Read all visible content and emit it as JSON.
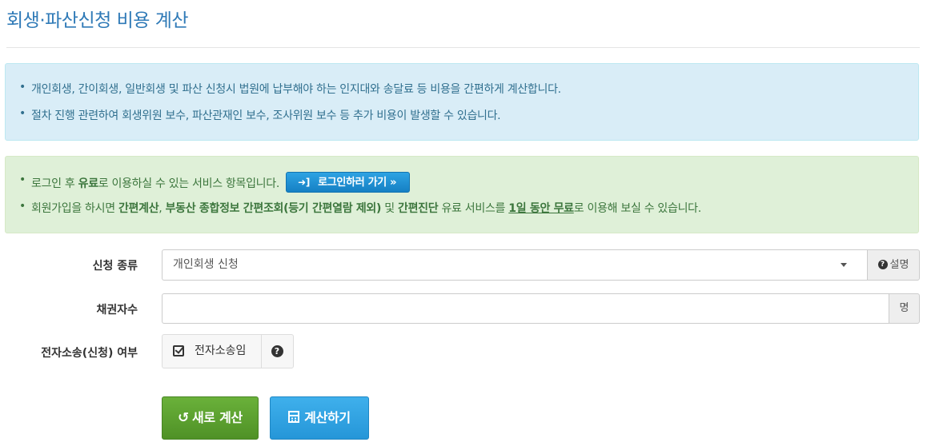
{
  "page": {
    "title": "회생·파산신청 비용 계산"
  },
  "info_alert": {
    "items": [
      "개인회생, 간이회생, 일반회생 및 파산 신청시 법원에 납부해야 하는 인지대와 송달료 등 비용을 간편하게 계산합니다.",
      "절차 진행 관련하여 회생위원 보수, 파산관재인 보수, 조사위원 보수 등 추가 비용이 발생할 수 있습니다."
    ]
  },
  "login_alert": {
    "line1_prefix": "로그인 후 ",
    "line1_bold": "유료",
    "line1_suffix": "로 이용하실 수 있는 서비스 항목입니다.",
    "login_button": "로그인하러 가기 »",
    "line2_a": "회원가입을 하시면 ",
    "line2_b": "간편계산",
    "line2_c": ", ",
    "line2_d": "부동산 종합정보 간편조회(등기 간편열람 제외)",
    "line2_e": " 및 ",
    "line2_f": "간편진단",
    "line2_g": " 유료 서비스를 ",
    "line2_h": "1일 동안 무료",
    "line2_i": "로 이용해 보실 수 있습니다."
  },
  "form": {
    "application_type_label": "신청 종류",
    "application_type_value": "개인회생 신청",
    "help_label": "설명",
    "creditors_label": "채권자수",
    "creditors_value": "",
    "creditors_unit": "명",
    "electronic_label": "전자소송(신청) 여부",
    "electronic_checkbox": "전자소송임",
    "electronic_checked": true
  },
  "buttons": {
    "reset": "새로 계산",
    "calculate": "계산하기"
  },
  "colors": {
    "title": "#2f7ab7",
    "info_bg": "#d9edf7",
    "success_bg": "#dff0d8",
    "reset_button": "#5ca32f",
    "calc_button": "#2ea3e3"
  }
}
